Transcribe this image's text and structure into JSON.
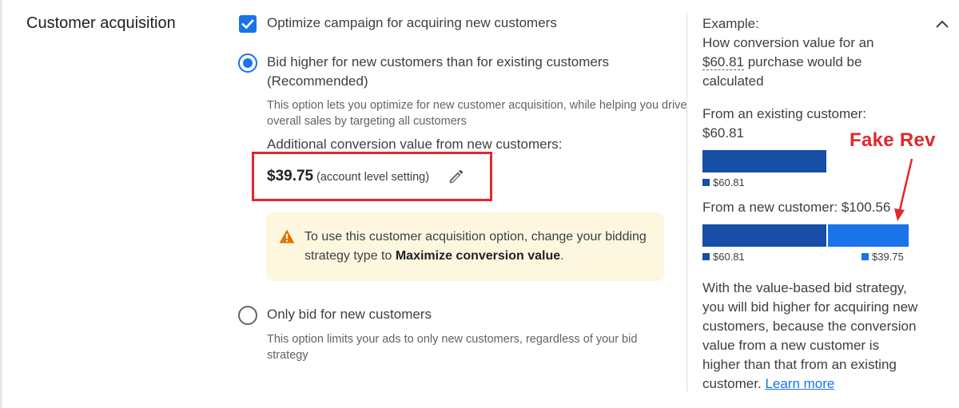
{
  "section": {
    "title": "Customer acquisition"
  },
  "optimize": {
    "label": "Optimize campaign for acquiring new customers",
    "checked": true
  },
  "option1": {
    "label_line1": "Bid higher for new customers than for existing customers",
    "label_line2": "(Recommended)",
    "selected": true,
    "description": "This option lets you optimize for new customer acquisition, while helping you drive overall sales by targeting all customers",
    "additional_label": "Additional conversion value from new customers:",
    "amount": "$39.75",
    "amount_note": "(account level setting)",
    "warning_text_pre": "To use this customer acquisition option, change your bidding strategy type to ",
    "warning_text_bold": "Maximize conversion value",
    "warning_text_post": "."
  },
  "option2": {
    "label": "Only bid for new customers",
    "selected": false,
    "description": "This option limits your ads to only new customers, regardless of your bid strategy"
  },
  "example": {
    "title": "Example:",
    "question_pre": "How conversion value for an ",
    "question_amount": "$60.81",
    "question_post": " purchase would be calculated",
    "existing_label": "From an existing customer:",
    "existing_value": "$60.81",
    "existing_legend": "$60.81",
    "new_label": "From a new customer: $100.56",
    "new_legend_base": "$60.81",
    "new_legend_extra": "$39.75",
    "body": "With the value-based bid strategy, you will bid higher for acquiring new customers, because the conversion value from a new customer is higher than that from an existing customer.",
    "learn_more": "Learn more"
  },
  "annotation": {
    "text": "Fake Rev"
  },
  "colors": {
    "accent": "#1a73e8",
    "dark_bar": "#174ea6",
    "warning_bg": "#fef7e0",
    "annotation": "#e3262b"
  },
  "icons": {
    "checkbox": "check-icon",
    "edit": "pencil-icon",
    "warning": "warning-triangle-icon",
    "collapse": "chevron-up-icon"
  }
}
